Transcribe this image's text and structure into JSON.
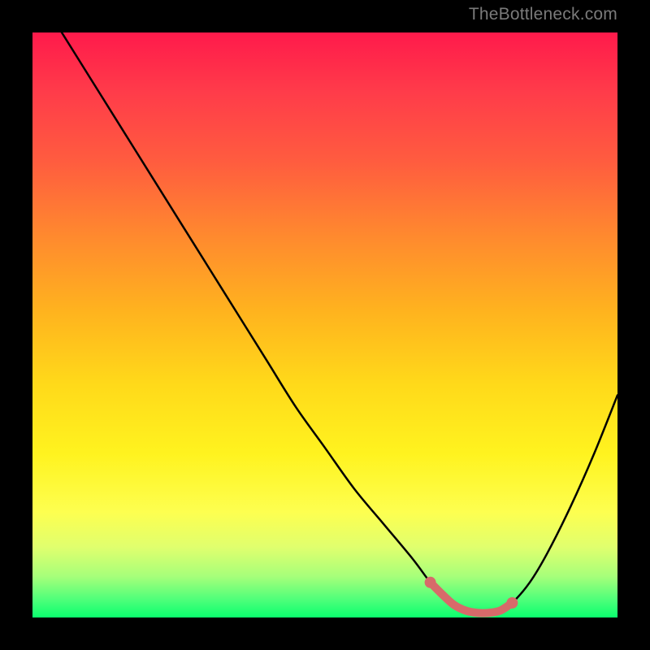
{
  "watermark": "TheBottleneck.com",
  "colors": {
    "curve": "#000000",
    "highlight_stroke": "#d76a6a",
    "highlight_fill": "#d76a6a"
  },
  "chart_data": {
    "type": "line",
    "title": "",
    "xlabel": "",
    "ylabel": "",
    "xlim": [
      0,
      100
    ],
    "ylim": [
      0,
      100
    ],
    "grid": false,
    "series": [
      {
        "name": "bottleneck-curve",
        "x": [
          5,
          10,
          15,
          20,
          25,
          30,
          35,
          40,
          45,
          50,
          55,
          60,
          65,
          68,
          70,
          72,
          74,
          76,
          78,
          80,
          82,
          85,
          88,
          92,
          96,
          100
        ],
        "values": [
          100,
          92,
          84,
          76,
          68,
          60,
          52,
          44,
          36,
          29,
          22,
          16,
          10,
          6,
          4,
          2.2,
          1.2,
          0.8,
          0.8,
          1.2,
          2.5,
          6,
          11,
          19,
          28,
          38
        ]
      }
    ],
    "annotations": [
      {
        "name": "optimal-range",
        "type": "highlight-segment",
        "x_start": 68,
        "x_end": 82,
        "basis_series": "bottleneck-curve",
        "endpoint_markers": true
      }
    ]
  }
}
